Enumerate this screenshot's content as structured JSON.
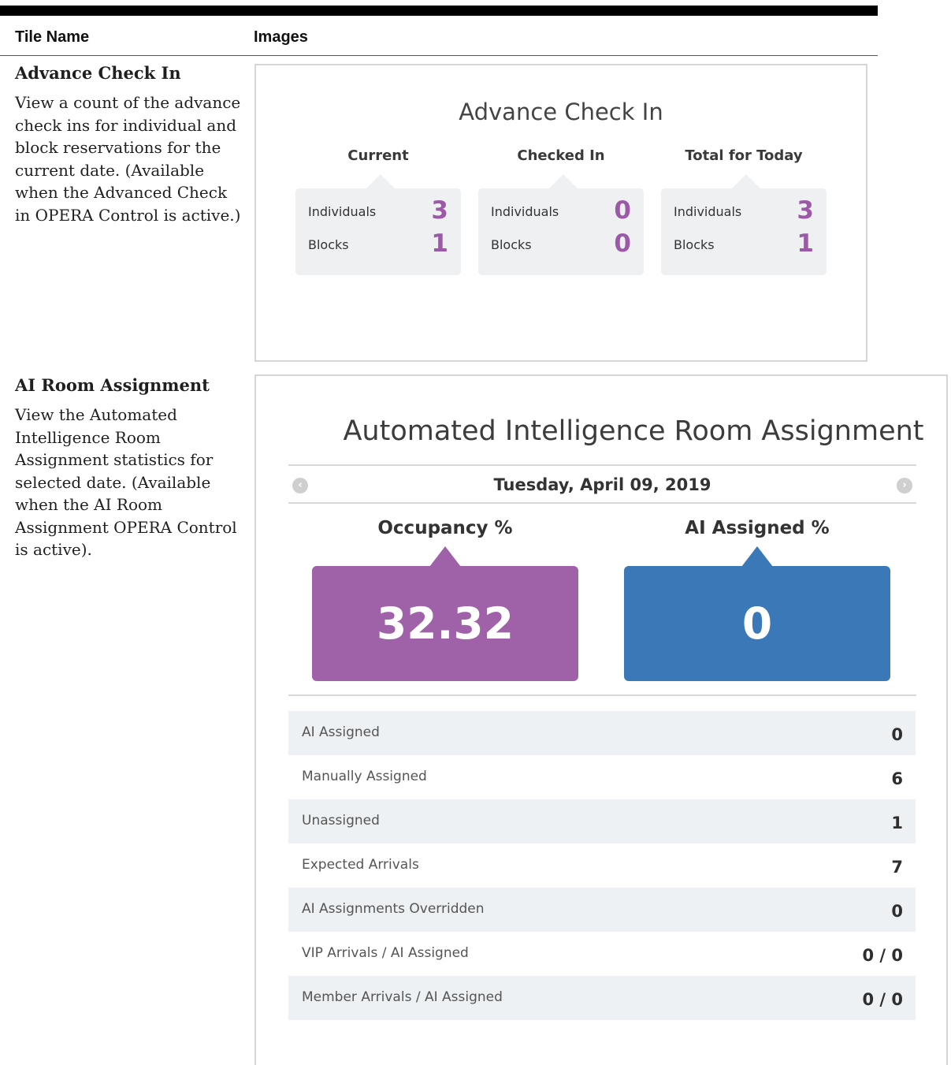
{
  "table": {
    "col_tile_name": "Tile Name",
    "col_images": "Images"
  },
  "rows": [
    {
      "name": "Advance Check In",
      "description": "View a count of the advance check ins for individual and block reservations for the current date. (Available when the Advanced Check in OPERA Control is active.)"
    },
    {
      "name": "AI Room Assignment",
      "description": "View the Automated Intelligence Room Assignment statistics for selected date. (Available when the AI Room Assignment OPERA Control is active)."
    }
  ],
  "advance_tile": {
    "title": "Advance Check In",
    "groups": [
      {
        "title": "Current",
        "individuals_label": "Individuals",
        "individuals": "3",
        "blocks_label": "Blocks",
        "blocks": "1"
      },
      {
        "title": "Checked In",
        "individuals_label": "Individuals",
        "individuals": "0",
        "blocks_label": "Blocks",
        "blocks": "0"
      },
      {
        "title": "Total for Today",
        "individuals_label": "Individuals",
        "individuals": "3",
        "blocks_label": "Blocks",
        "blocks": "1"
      }
    ],
    "value_color": "#9b59a8"
  },
  "ai_tile": {
    "title": "Automated Intelligence Room Assignment",
    "date": "Tuesday, April 09, 2019",
    "prev_icon": "chevron-left-icon",
    "next_icon": "chevron-right-icon",
    "occupancy_label": "Occupancy %",
    "occupancy_value": "32.32",
    "occupancy_color": "#9f61a8",
    "ai_assigned_label": "AI Assigned %",
    "ai_assigned_value": "0",
    "ai_assigned_color": "#3a78b8",
    "stats": [
      {
        "label": "AI Assigned",
        "value": "0"
      },
      {
        "label": "Manually Assigned",
        "value": "6"
      },
      {
        "label": "Unassigned",
        "value": "1"
      },
      {
        "label": "Expected Arrivals",
        "value": "7"
      },
      {
        "label": "AI Assignments Overridden",
        "value": "0"
      },
      {
        "label": "VIP Arrivals / AI Assigned",
        "value": "0 / 0"
      },
      {
        "label": "Member Arrivals / AI Assigned",
        "value": "0 / 0"
      }
    ]
  }
}
